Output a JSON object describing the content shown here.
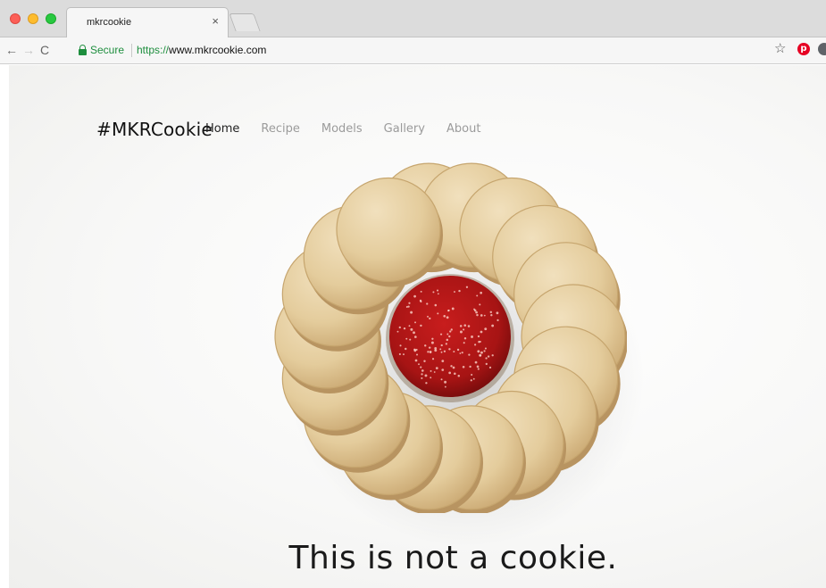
{
  "browser": {
    "tab_title": "mkrcookie",
    "tab_close": "×",
    "nav_back": "←",
    "nav_forward": "→",
    "nav_reload": "C",
    "secure_label": "Secure",
    "url_scheme": "https://",
    "url_host": "www.mkrcookie.com",
    "bookmark_star": "☆",
    "pinterest_glyph": "p",
    "icons": [
      "lock-icon",
      "star-icon",
      "pinterest-icon",
      "extension-icon"
    ]
  },
  "site": {
    "brand": "#MKRCookie",
    "nav": [
      {
        "label": "Home",
        "active": true
      },
      {
        "label": "Recipe",
        "active": false
      },
      {
        "label": "Models",
        "active": false
      },
      {
        "label": "Gallery",
        "active": false
      },
      {
        "label": "About",
        "active": false
      }
    ],
    "headline": "This is not a cookie."
  },
  "colors": {
    "wood": "#e6cfa2",
    "wood_edge": "#c9aa73",
    "jam": "#b01515",
    "secure_green": "#1e8e3e"
  }
}
